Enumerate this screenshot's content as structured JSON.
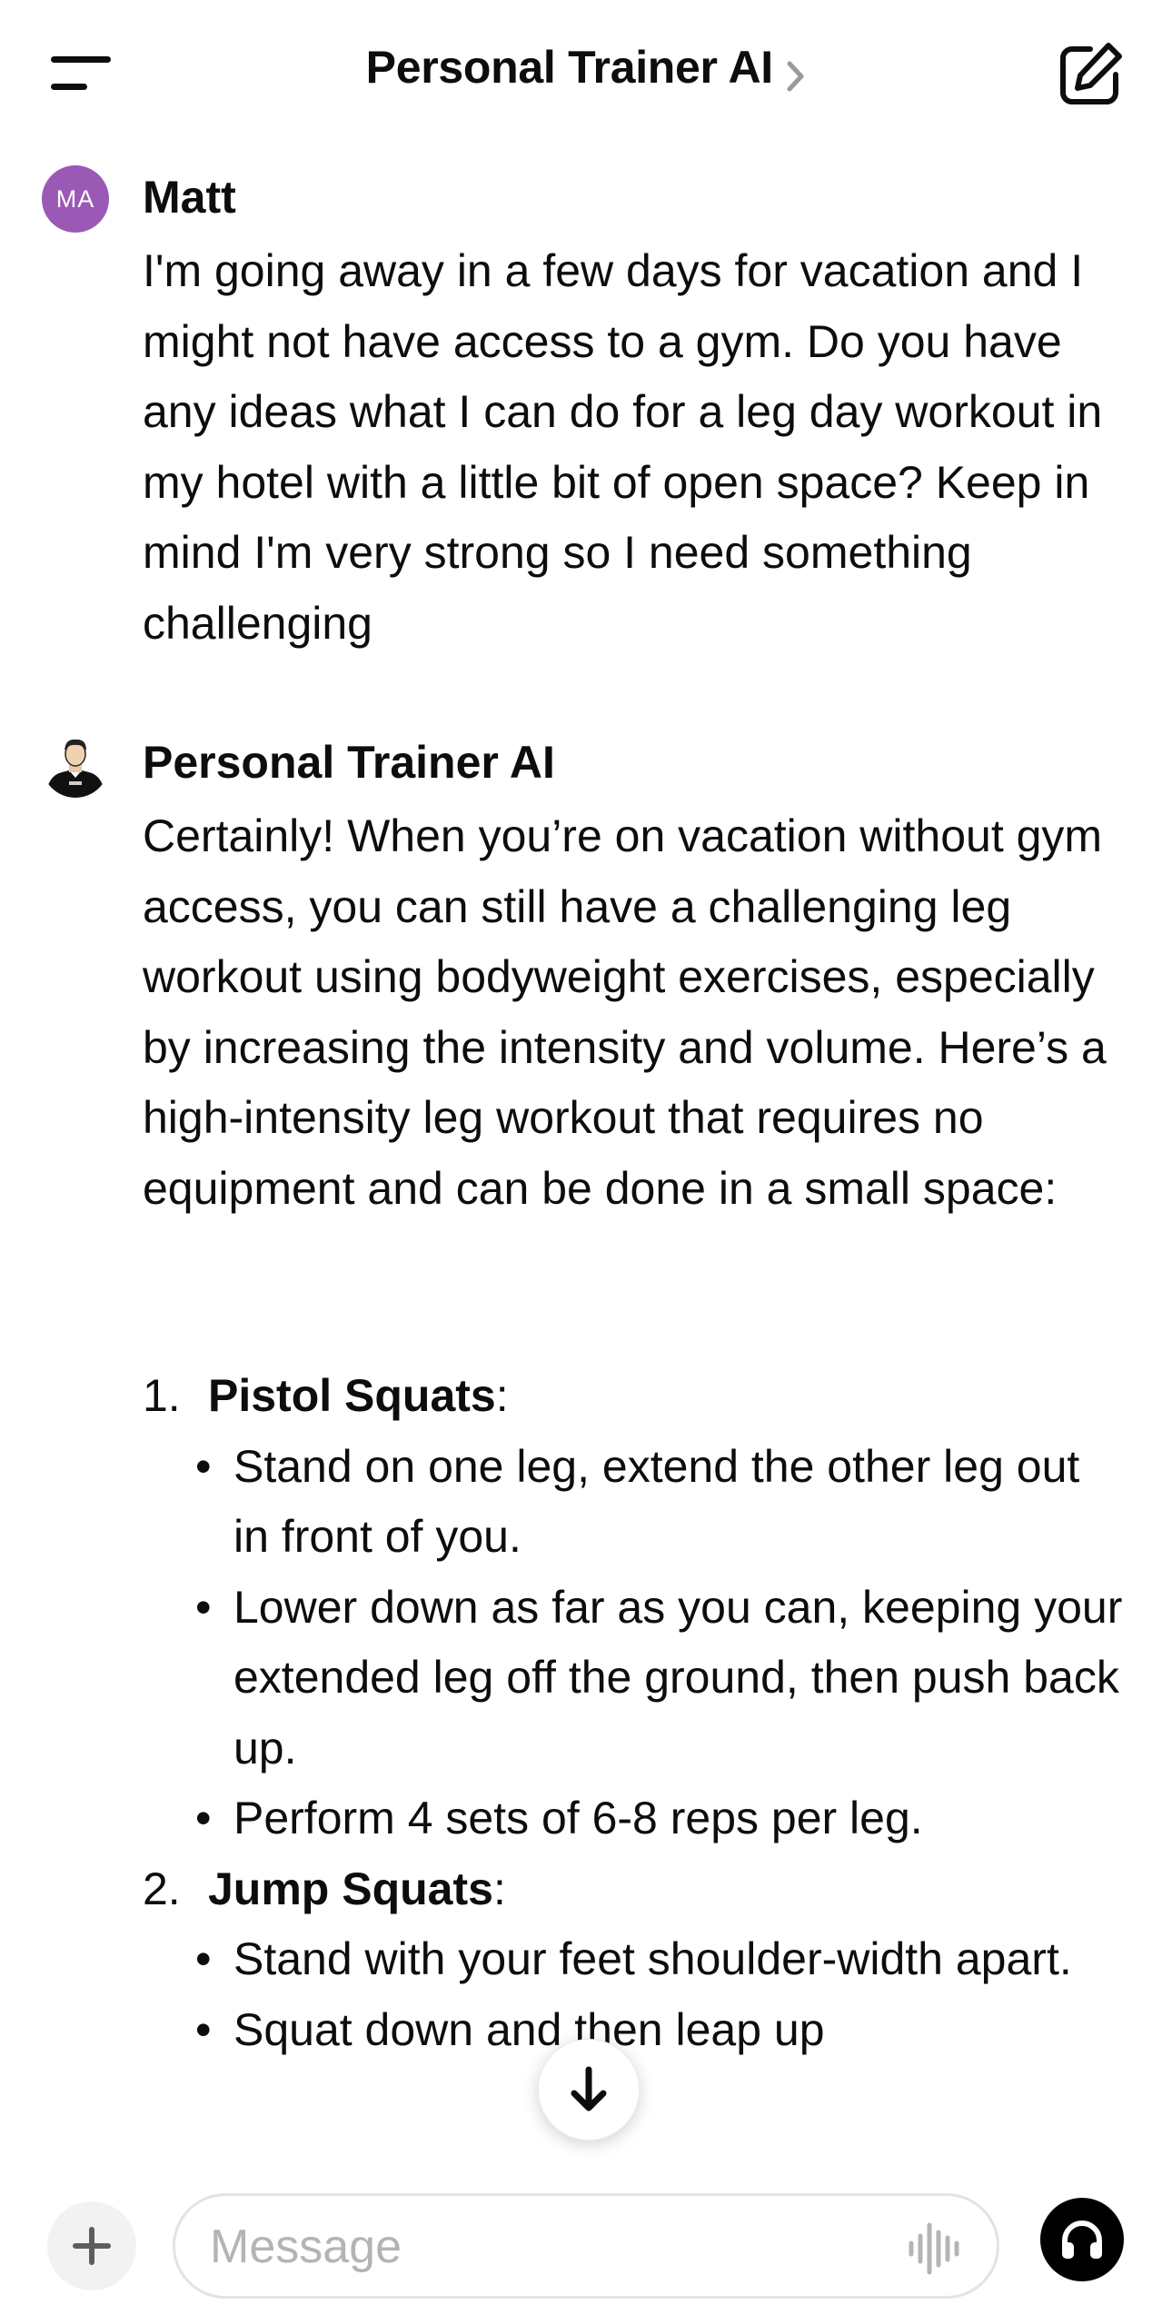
{
  "header": {
    "title": "Personal Trainer AI",
    "menu_icon": "menu-icon",
    "new_chat_icon": "compose-icon"
  },
  "messages": [
    {
      "sender": "Matt",
      "avatar_initials": "MA",
      "avatar_color": "#9b59b6",
      "text": "I'm going away in a few days for vacation and I might not have access to a gym. Do you have any ideas what I can do for a leg day workout in my hotel with a little bit of open space? Keep in mind I'm very strong so I need something challenging"
    },
    {
      "sender": "Personal Trainer AI",
      "intro": "Certainly! When you’re on vacation without gym access, you can still have a challenging leg workout using bodyweight exercises, especially by increasing the intensity and volume. Here’s a high-intensity leg workout that requires no equipment and can be done in a small space:",
      "exercises": [
        {
          "number": "1.",
          "name": "Pistol Squats",
          "suffix": ":",
          "steps": [
            "Stand on one leg, extend the other leg out in front of you.",
            "Lower down as far as you can, keeping your extended leg off the ground, then push back up.",
            "Perform 4 sets of 6-8 reps per leg."
          ]
        },
        {
          "number": "2.",
          "name": "Jump Squats",
          "suffix": ":",
          "steps": [
            "Stand with your feet shoulder-width apart.",
            "Squat down and then leap up"
          ]
        }
      ]
    }
  ],
  "composer": {
    "placeholder": "Message",
    "value": ""
  }
}
